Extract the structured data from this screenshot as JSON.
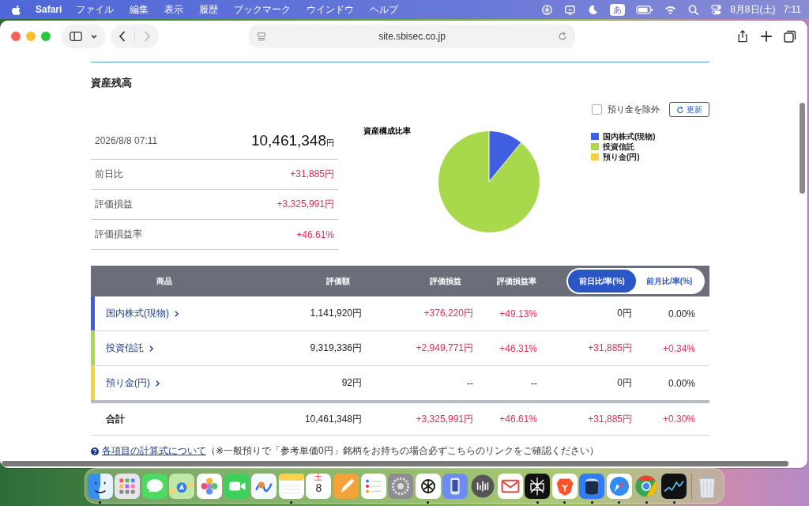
{
  "menu_bar": {
    "app": "Safari",
    "menus": [
      "ファイル",
      "編集",
      "表示",
      "履歴",
      "ブックマーク",
      "ウインドウ",
      "ヘルプ"
    ],
    "input_mode": "あ",
    "date": "8月8日(土)",
    "time": "7:11"
  },
  "browser": {
    "url": "site.sbisec.co.jp",
    "back": {
      "disabled": false
    },
    "forward": {
      "disabled": true
    }
  },
  "page": {
    "title": "資産残高",
    "exclude_cash": {
      "label": "預り金を除外",
      "checked": false
    },
    "refresh": "更新",
    "summary": {
      "datetime": "2026/8/8 07:11",
      "total": "10,461,348",
      "total_unit": "円",
      "rows": [
        {
          "label": "前日比",
          "value": "+31,885円"
        },
        {
          "label": "評価損益",
          "value": "+3,325,991円"
        },
        {
          "label": "評価損益率",
          "value": "+46.61%"
        }
      ]
    },
    "chart": {
      "title": "資産構成比率",
      "legend": [
        {
          "label": "国内株式(現物)",
          "color": "#3f5fe0"
        },
        {
          "label": "投資信託",
          "color": "#a8d84b"
        },
        {
          "label": "預り金(円)",
          "color": "#f2d33a"
        }
      ]
    },
    "table": {
      "columns": [
        "商品",
        "評価額",
        "評価損益",
        "評価損益率"
      ],
      "toggle": [
        {
          "label": "前日比/率(%)",
          "selected": true
        },
        {
          "label": "前月比/率(%)",
          "selected": false
        }
      ],
      "rows": [
        {
          "color": "#3f5fe0",
          "cells": [
            {
              "kind": "link",
              "text": "国内株式(現物)",
              "up": false
            },
            {
              "kind": "value",
              "text": "1,141,920円",
              "up": false
            },
            {
              "kind": "value",
              "text": "+376,220円",
              "up": true
            },
            {
              "kind": "value",
              "text": "+49.13%",
              "up": true
            },
            {
              "kind": "value",
              "text": "0円",
              "up": false
            },
            {
              "kind": "value",
              "text": "0.00%",
              "up": false
            }
          ]
        },
        {
          "color": "#a8d84b",
          "cells": [
            {
              "kind": "link",
              "text": "投資信託",
              "up": false
            },
            {
              "kind": "value",
              "text": "9,319,336円",
              "up": false
            },
            {
              "kind": "value",
              "text": "+2,949,771円",
              "up": true
            },
            {
              "kind": "value",
              "text": "+46.31%",
              "up": true
            },
            {
              "kind": "value",
              "text": "+31,885円",
              "up": true
            },
            {
              "kind": "value",
              "text": "+0.34%",
              "up": true
            }
          ]
        },
        {
          "color": "#f2d33a",
          "cells": [
            {
              "kind": "link",
              "text": "預り金(円)",
              "up": false
            },
            {
              "kind": "value",
              "text": "92円",
              "up": false
            },
            {
              "kind": "value",
              "text": "--",
              "up": false
            },
            {
              "kind": "value",
              "text": "--",
              "up": false
            },
            {
              "kind": "value",
              "text": "0円",
              "up": false
            },
            {
              "kind": "value",
              "text": "0.00%",
              "up": false
            }
          ]
        }
      ],
      "total": {
        "cells": [
          {
            "kind": "label",
            "text": "合計",
            "up": false
          },
          {
            "kind": "value",
            "text": "10,461,348円",
            "up": false
          },
          {
            "kind": "value",
            "text": "+3,325,991円",
            "up": true
          },
          {
            "kind": "value",
            "text": "+46.61%",
            "up": true
          },
          {
            "kind": "value",
            "text": "+31,885円",
            "up": true
          },
          {
            "kind": "value",
            "text": "+0.30%",
            "up": true
          }
        ]
      }
    },
    "note": {
      "link": "各項目の計算式について",
      "text": "（※一般預りで「参考単価0円」銘柄をお持ちの場合必ずこちらのリンクをご確認ください）"
    }
  },
  "dock": {
    "apps": [
      {
        "kind": "finder",
        "running": true
      },
      {
        "kind": "launchpad",
        "running": false
      },
      {
        "kind": "messages",
        "running": false
      },
      {
        "kind": "maps",
        "running": false
      },
      {
        "kind": "photos",
        "running": false
      },
      {
        "kind": "facetime",
        "running": false
      },
      {
        "kind": "freeform",
        "running": false
      },
      {
        "kind": "notes",
        "running": true
      },
      {
        "kind": "calendar",
        "running": false,
        "weekday": "土",
        "day": "8"
      },
      {
        "kind": "pages",
        "running": false
      },
      {
        "kind": "reminders",
        "running": false
      },
      {
        "kind": "settings",
        "running": false
      },
      {
        "kind": "knot",
        "running": true
      },
      {
        "kind": "phone",
        "running": false
      },
      {
        "kind": "bars",
        "running": false
      },
      {
        "kind": "mail",
        "running": false
      },
      {
        "kind": "star",
        "running": true
      },
      {
        "kind": "lion",
        "running": true
      },
      {
        "kind": "jar",
        "running": true
      },
      {
        "kind": "compass",
        "running": true
      },
      {
        "kind": "chrome",
        "running": true
      },
      {
        "kind": "stocks",
        "running": true
      }
    ],
    "trash": {
      "kind": "trash"
    }
  }
}
